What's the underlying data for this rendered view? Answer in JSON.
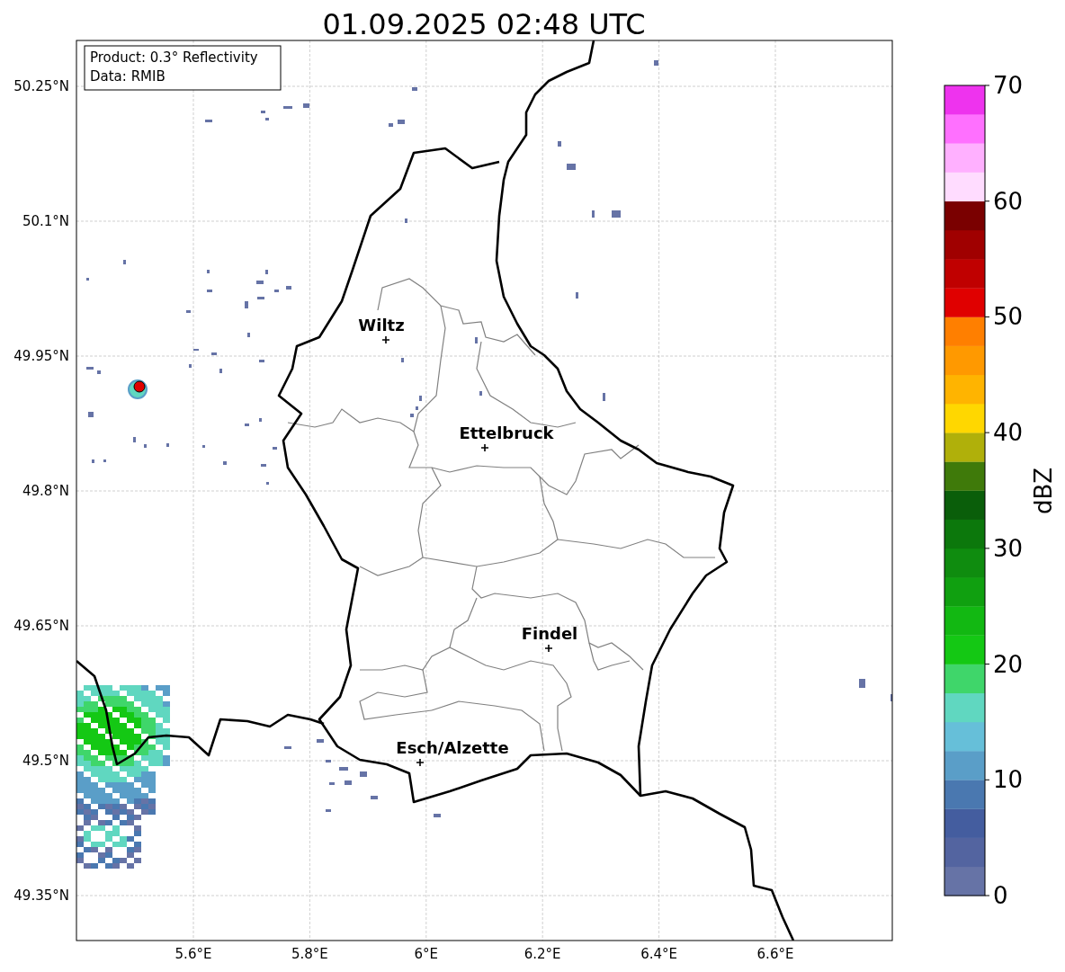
{
  "title": "01.09.2025 02:48 UTC",
  "annotation": [
    "Product: 0.3° Reflectivity",
    "Data: RMIB"
  ],
  "map": {
    "y_ticks": [
      "50.25°N",
      "50.1°N",
      "49.95°N",
      "49.8°N",
      "49.65°N",
      "49.5°N",
      "49.35°N"
    ],
    "x_ticks": [
      "5.6°E",
      "5.8°E",
      "6°E",
      "6.2°E",
      "6.4°E",
      "6.6°E"
    ],
    "cities": [
      {
        "name": "Wiltz"
      },
      {
        "name": "Ettelbruck"
      },
      {
        "name": "Findel"
      },
      {
        "name": "Esch/Alzette"
      }
    ]
  },
  "colorbar": {
    "label": "dBZ",
    "ticks": [
      "70",
      "60",
      "50",
      "40",
      "30",
      "20",
      "10",
      "0"
    ],
    "segments": [
      {
        "color": "#6673a6"
      },
      {
        "color": "#5364a0"
      },
      {
        "color": "#445d9f"
      },
      {
        "color": "#4a78b0"
      },
      {
        "color": "#5a9ec8"
      },
      {
        "color": "#66bfd9"
      },
      {
        "color": "#60d7c0"
      },
      {
        "color": "#3fd66a"
      },
      {
        "color": "#14c814"
      },
      {
        "color": "#12b812"
      },
      {
        "color": "#10a010"
      },
      {
        "color": "#0f8c0f"
      },
      {
        "color": "#0c780c"
      },
      {
        "color": "#0a5e0a"
      },
      {
        "color": "#3f7a0a"
      },
      {
        "color": "#b0b00a"
      },
      {
        "color": "#ffd700"
      },
      {
        "color": "#ffb400"
      },
      {
        "color": "#ff9900"
      },
      {
        "color": "#ff7f00"
      },
      {
        "color": "#e00000"
      },
      {
        "color": "#c00000"
      },
      {
        "color": "#a00000"
      },
      {
        "color": "#7a0000"
      },
      {
        "color": "#ffdcff"
      },
      {
        "color": "#ffb0ff"
      },
      {
        "color": "#ff70ff"
      },
      {
        "color": "#ee33ee"
      }
    ]
  }
}
